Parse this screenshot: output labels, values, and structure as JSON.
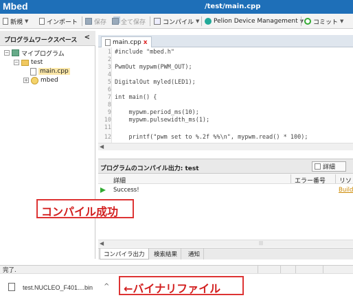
{
  "window": {
    "app_title": "Mbed",
    "path": "/test/main.cpp"
  },
  "toolbar": {
    "new_label": "新規",
    "import_label": "インポート",
    "save_label": "保存",
    "save_all_label": "全て保存",
    "compile_label": "コンパイル",
    "pelion_label": "Pelion Device Management",
    "commit_label": "コミット"
  },
  "workspace": {
    "title": "プログラムワークスペース",
    "collapse": "<",
    "items": [
      {
        "toggle": "⊟",
        "label": "マイプログラム"
      },
      {
        "toggle": "⊟",
        "label": "test"
      },
      {
        "toggle": "",
        "label": "main.cpp"
      },
      {
        "toggle": "⊞",
        "label": "mbed"
      }
    ]
  },
  "editor": {
    "tab_label": "main.cpp",
    "tab_close": "x",
    "lines": [
      {
        "n": "1",
        "code": "#include \"mbed.h\""
      },
      {
        "n": "2",
        "code": ""
      },
      {
        "n": "3",
        "code": "PwmOut mypwm(PWM_OUT);"
      },
      {
        "n": "4",
        "code": ""
      },
      {
        "n": "5",
        "code": "DigitalOut myled(LED1);"
      },
      {
        "n": "6",
        "code": ""
      },
      {
        "n": "7",
        "code": "int main() {"
      },
      {
        "n": "8",
        "code": ""
      },
      {
        "n": "9",
        "code": "    mypwm.period_ms(10);"
      },
      {
        "n": "10",
        "code": "    mypwm.pulsewidth_ms(1);"
      },
      {
        "n": "11",
        "code": ""
      },
      {
        "n": "12",
        "code": "    printf(\"pwm set to %.2f %%\\n\", mypwm.read() * 100);"
      }
    ]
  },
  "output": {
    "title": "プログラムのコンパイル出力: test",
    "detail_label": "詳細",
    "col_detail": "詳細",
    "col_error": "エラー番号",
    "col_resource": "リソ",
    "row_status": "Success!",
    "row_link": "Build",
    "tabs": [
      "コンパイラ出力",
      "検索結果",
      "通知"
    ]
  },
  "status": {
    "text": "完了."
  },
  "download": {
    "filename": "test.NUCLEO_F401....bin",
    "caret": "^"
  },
  "annotations": {
    "compile_success": "コンパイル成功",
    "binary_file": "←バイナリファイル"
  },
  "colors": {
    "title_bar": "#1e6fb8",
    "annotation": "#d21f1f",
    "success": "#33aa33"
  }
}
